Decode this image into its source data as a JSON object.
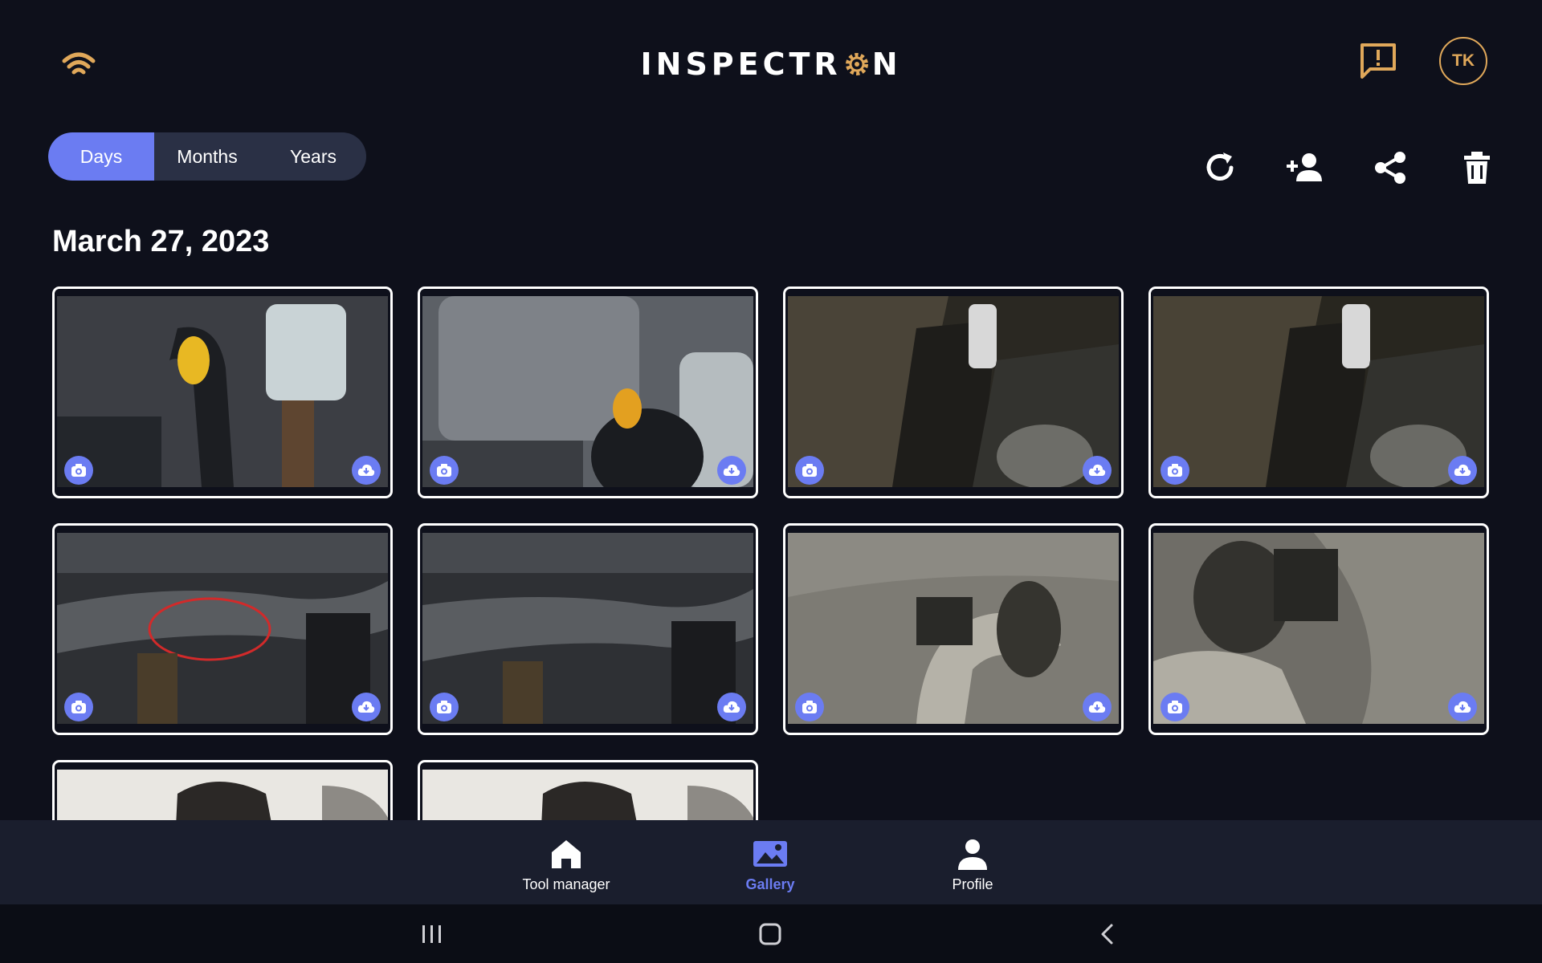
{
  "header": {
    "logo_left": "INSPECTR",
    "logo_right": "N",
    "avatar_initials": "TK"
  },
  "tabs": [
    {
      "label": "Days",
      "active": true
    },
    {
      "label": "Months",
      "active": false
    },
    {
      "label": "Years",
      "active": false
    }
  ],
  "gallery": {
    "date_heading": "March 27, 2023",
    "photos": [
      {
        "type": "photo"
      },
      {
        "type": "photo"
      },
      {
        "type": "photo"
      },
      {
        "type": "photo"
      },
      {
        "type": "photo"
      },
      {
        "type": "photo"
      },
      {
        "type": "photo"
      },
      {
        "type": "photo"
      },
      {
        "type": "photo"
      },
      {
        "type": "photo"
      }
    ]
  },
  "bottom_nav": [
    {
      "label": "Tool manager",
      "icon": "home-icon",
      "active": false
    },
    {
      "label": "Gallery",
      "icon": "gallery-icon",
      "active": true
    },
    {
      "label": "Profile",
      "icon": "person-icon",
      "active": false
    }
  ],
  "icons": {
    "status": "wifi-icon",
    "feedback": "feedback-icon",
    "refresh": "refresh-icon",
    "add_user": "add-user-icon",
    "share": "share-icon",
    "delete": "trash-icon",
    "photo_badge": "camera-icon",
    "download_badge": "cloud-download-icon"
  },
  "colors": {
    "background": "#0e101b",
    "accent": "#6b7cf2",
    "gold": "#e0a85a",
    "nav_background": "#1a1e2d",
    "segment_background": "#2a3045"
  }
}
